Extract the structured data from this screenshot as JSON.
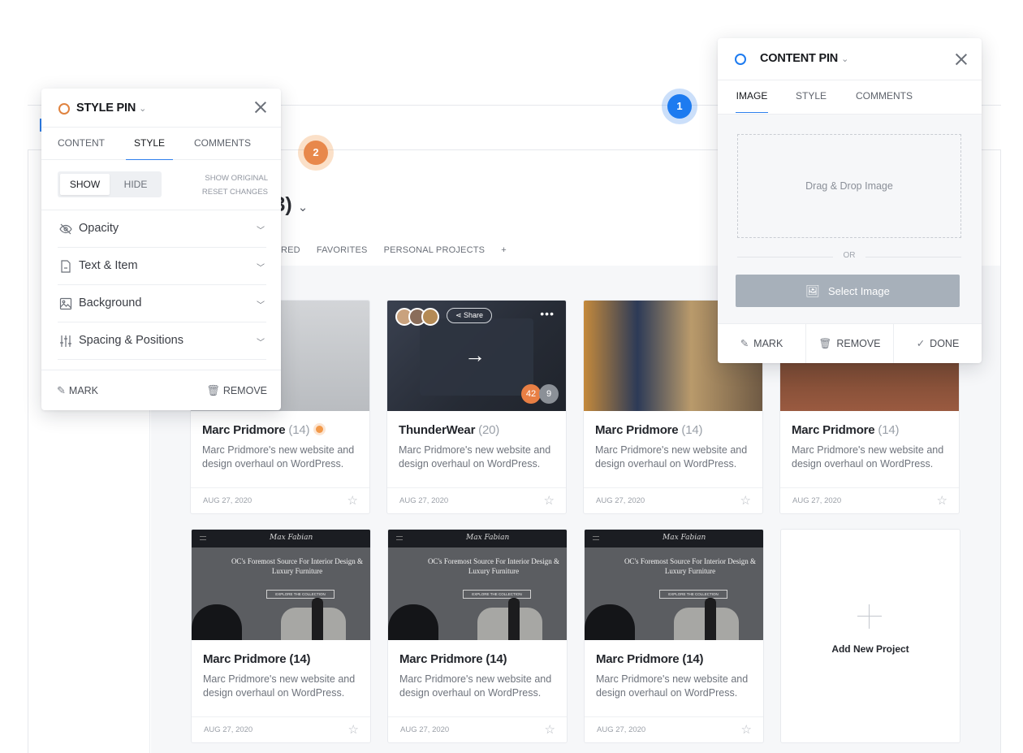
{
  "page": {
    "title": "ts (3)",
    "title_caret": "⌄",
    "categories": [
      "RED",
      "FAVORITES",
      "PERSONAL PROJECTS",
      "+"
    ]
  },
  "pins": [
    {
      "number": "1",
      "color": "#1d7bf0"
    },
    {
      "number": "2",
      "color": "#e8884b"
    }
  ],
  "cards": [
    {
      "name": "Marc Pridmore",
      "count": "(14)",
      "desc": "Marc Pridmore's new website and design overhaul on WordPress.",
      "date": "AUG 27, 2020",
      "thumb": "camera",
      "marked": true
    },
    {
      "name": "ThunderWear",
      "count": "(20)",
      "desc": "Marc Pridmore's new website and design overhaul on WordPress.",
      "date": "AUG 27, 2020",
      "thumb": "laptop",
      "share": "Share",
      "badges": [
        "42",
        "9"
      ]
    },
    {
      "name": "Marc Pridmore",
      "count": "(14)",
      "desc": "Marc Pridmore's new website and design overhaul on WordPress.",
      "date": "AUG 27, 2020",
      "thumb": "cafe"
    },
    {
      "name": "Marc Pridmore",
      "count": "(14)",
      "desc": "Marc Pridmore's new website and design overhaul on WordPress.",
      "date": "AUG 27, 2020",
      "thumb": "wood"
    },
    {
      "name": "Marc Pridmore (14)",
      "count": "",
      "desc": "Marc Pridmore's new website and design overhaul on WordPress.",
      "date": "AUG 27, 2020",
      "thumb": "interior"
    },
    {
      "name": "Marc Pridmore (14)",
      "count": "",
      "desc": "Marc Pridmore's new website and design overhaul on WordPress.",
      "date": "AUG 27, 2020",
      "thumb": "interior"
    },
    {
      "name": "Marc Pridmore (14)",
      "count": "",
      "desc": "Marc Pridmore's new website and design overhaul on WordPress.",
      "date": "AUG 27, 2020",
      "thumb": "interior"
    }
  ],
  "interior_thumb": {
    "logo": "Max Fabian",
    "headline": "OC's Foremost Source For Interior Design & Luxury Furniture",
    "button": "EXPLORE THE COLLECTION"
  },
  "add_card": {
    "label": "Add New Project"
  },
  "style_pin": {
    "title": "STYLE PIN",
    "chevron": "⌄",
    "tabs": [
      "CONTENT",
      "STYLE",
      "COMMENTS"
    ],
    "active_tab": "STYLE",
    "toggle": {
      "show": "SHOW",
      "hide": "HIDE"
    },
    "links": {
      "show_original": "SHOW ORIGINAL",
      "reset": "RESET CHANGES"
    },
    "sections": [
      {
        "label": "Opacity",
        "icon": "eye-off-icon"
      },
      {
        "label": "Text & Item",
        "icon": "document-icon"
      },
      {
        "label": "Background",
        "icon": "image-icon"
      },
      {
        "label": "Spacing & Positions",
        "icon": "sliders-icon"
      }
    ],
    "footer": {
      "mark": "MARK",
      "remove": "REMOVE"
    }
  },
  "content_pin": {
    "title": "CONTENT PIN",
    "chevron": "⌄",
    "tabs": [
      "IMAGE",
      "STYLE",
      "COMMENTS"
    ],
    "active_tab": "IMAGE",
    "dropzone": "Drag & Drop Image",
    "or": "OR",
    "select_button": "Select Image",
    "footer": {
      "mark": "MARK",
      "remove": "REMOVE",
      "done": "DONE"
    }
  },
  "colors": {
    "accent": "#2f80ed",
    "style_pin": "#e0833f",
    "content_pin": "#1d7bf0"
  }
}
